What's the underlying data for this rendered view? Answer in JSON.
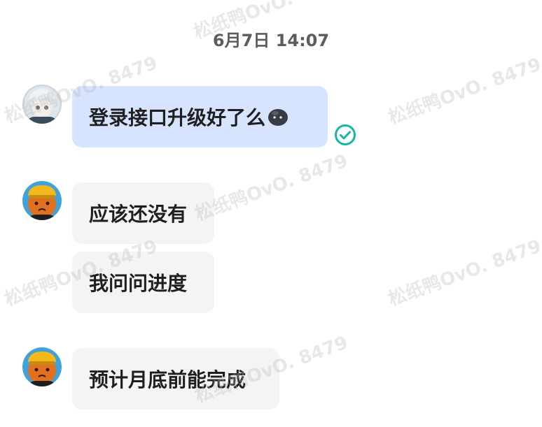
{
  "timestamp": "6月7日 14:07",
  "watermark": "松纸鸭OvO. 8479",
  "messages": [
    {
      "sender": "self",
      "text": "登录接口升级好了么",
      "emoji": "blob-emoji",
      "status": "read-check-icon"
    },
    {
      "sender": "other",
      "text": "应该还没有"
    },
    {
      "sender": "other",
      "text": "我问问进度"
    },
    {
      "sender": "other",
      "text": "预计月底前能完成"
    }
  ],
  "colors": {
    "self_bubble": "#d6e4ff",
    "other_bubble": "#f3f4f6",
    "check": "#15b8a0"
  }
}
